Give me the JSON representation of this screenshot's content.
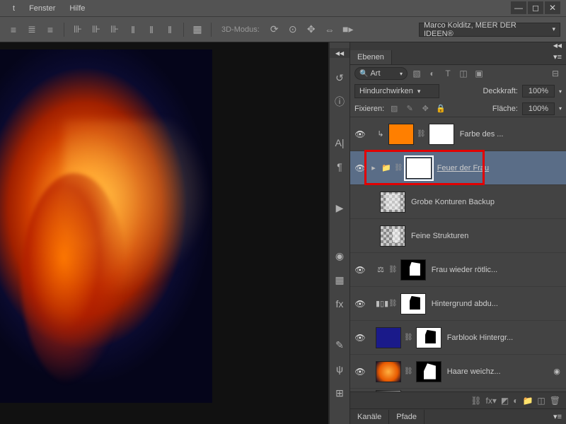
{
  "menu": {
    "item1": "t",
    "fenster": "Fenster",
    "hilfe": "Hilfe"
  },
  "options": {
    "mode3d_label": "3D-Modus:",
    "workspace": "Marco Kolditz, MEER DER IDEEN®"
  },
  "panel": {
    "ebenen_tab": "Ebenen",
    "search_label": "Art",
    "blend_mode": "Hindurchwirken",
    "opacity_label": "Deckkraft:",
    "opacity_value": "100%",
    "lock_label": "Fixieren:",
    "fill_label": "Fläche:",
    "fill_value": "100%"
  },
  "layers": [
    {
      "name": "Farbe des ...",
      "vis": true
    },
    {
      "name": "Feuer der Frau",
      "vis": true
    },
    {
      "name": "Grobe Konturen Backup",
      "vis": false
    },
    {
      "name": "Feine Strukturen",
      "vis": false
    },
    {
      "name": "Frau wieder rötlic...",
      "vis": true
    },
    {
      "name": "Hintergrund abdu...",
      "vis": true
    },
    {
      "name": "Farblook Hintergr...",
      "vis": true
    },
    {
      "name": "Haare weichz...",
      "vis": true
    }
  ],
  "footer_tabs": {
    "kanaele": "Kanäle",
    "pfade": "Pfade"
  }
}
